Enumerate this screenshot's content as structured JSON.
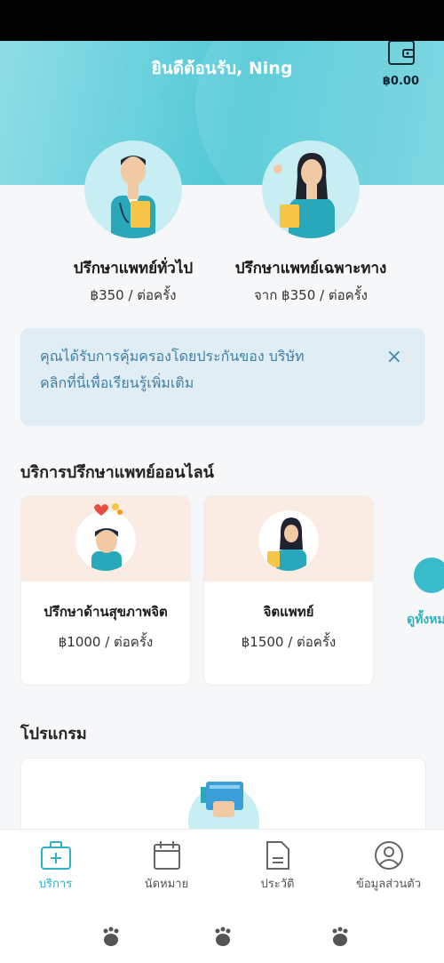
{
  "header": {
    "greeting": "ยินดีต้อนรับ, Ning",
    "balance": "฿0.00"
  },
  "consultations": [
    {
      "title": "ปรึกษาแพทย์ทั่วไป",
      "price": "฿350 / ต่อครั้ง"
    },
    {
      "title": "ปรึกษาแพทย์เฉพาะทาง",
      "price": "จาก ฿350 / ต่อครั้ง"
    }
  ],
  "insurance_banner": {
    "line1": "คุณได้รับการคุ้มครองโดยประกันของ บริษัท",
    "line2": "คลิกที่นี่เพื่อเรียนรู้เพิ่มเติม",
    "close": "×"
  },
  "online_services": {
    "title": "บริการปรึกษาแพทย์ออนไลน์",
    "cards": [
      {
        "title": "ปรึกษาด้านสุขภาพจิต",
        "price": "฿1000 / ต่อครั้ง"
      },
      {
        "title": "จิตแพทย์",
        "price": "฿1500 / ต่อครั้ง"
      }
    ],
    "see_all": "ดูทั้งหมด"
  },
  "programs": {
    "title": "โปรแกรม"
  },
  "bottom_nav": [
    {
      "label": "บริการ",
      "icon": "medical-kit-icon",
      "active": true
    },
    {
      "label": "นัดหมาย",
      "icon": "calendar-icon",
      "active": false
    },
    {
      "label": "ประวัติ",
      "icon": "document-icon",
      "active": false
    },
    {
      "label": "ข้อมูลส่วนตัว",
      "icon": "user-circle-icon",
      "active": false
    }
  ],
  "colors": {
    "accent": "#2fb3c3",
    "hero": "#4fc8d6",
    "banner_bg": "#e1edf5",
    "banner_text": "#3e80a8"
  }
}
